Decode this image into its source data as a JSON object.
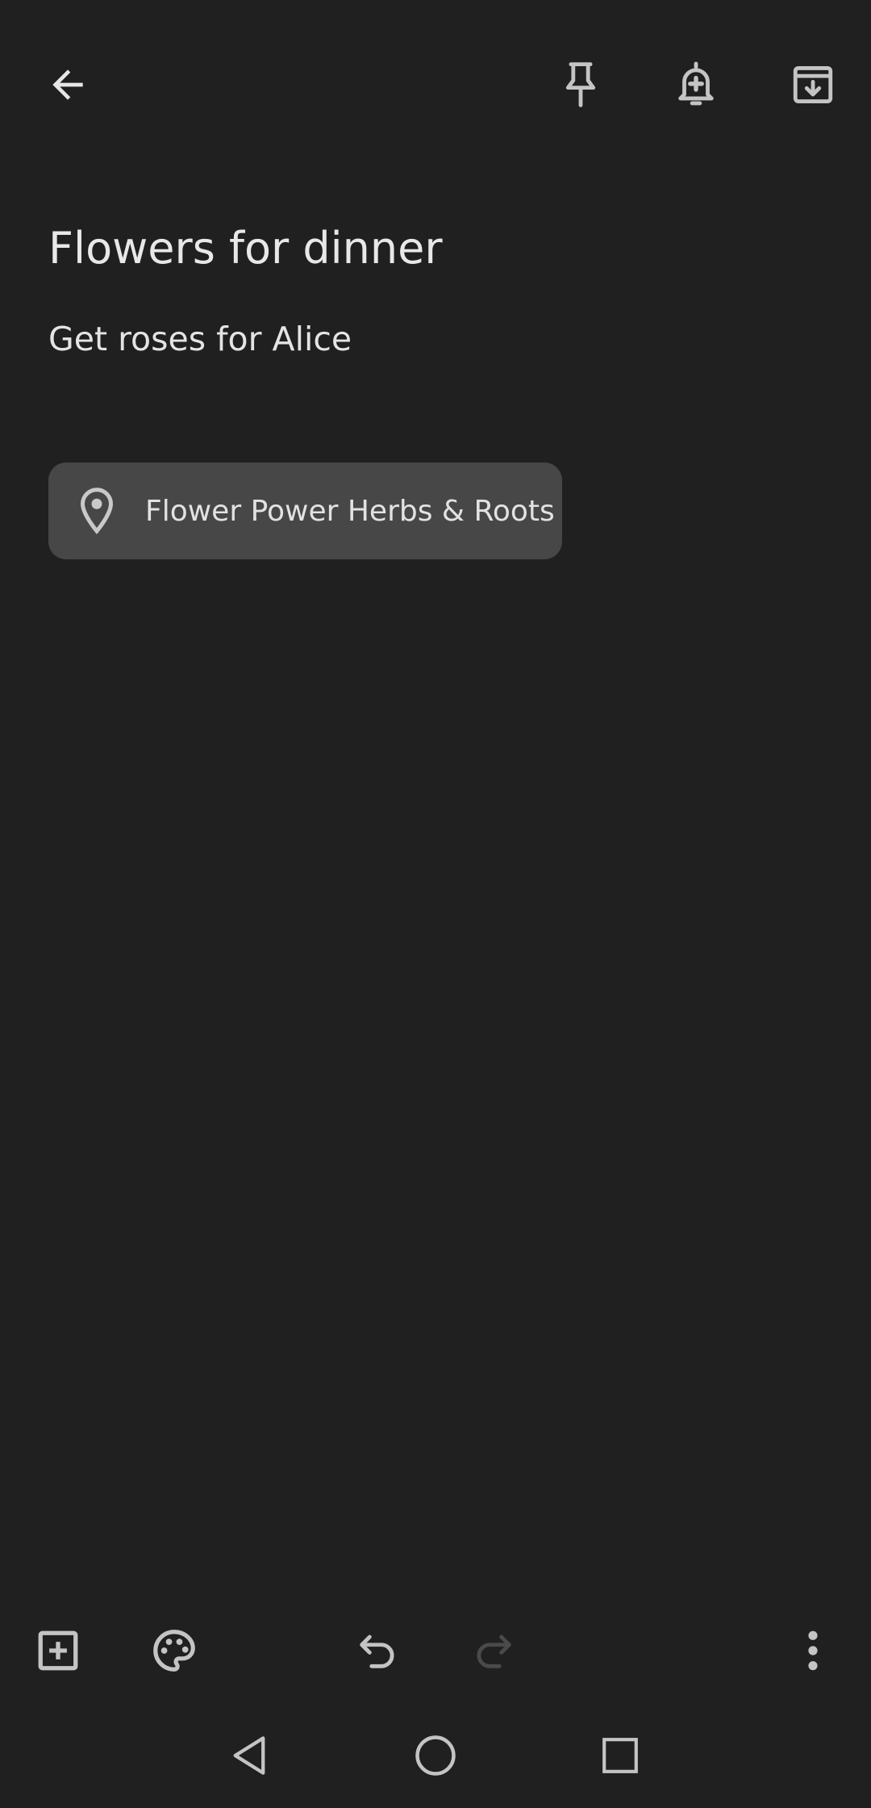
{
  "toolbar": {
    "back_icon": "arrow-back-icon",
    "pin_icon": "pin-icon",
    "reminder_icon": "add-reminder-icon",
    "archive_icon": "archive-icon"
  },
  "note": {
    "title": "Flowers for dinner",
    "body": "Get roses for Alice"
  },
  "location": {
    "icon": "location-pin-icon",
    "label": "Flower Power Herbs & Roots"
  },
  "bottom_bar": {
    "add_icon": "add-box-icon",
    "palette_icon": "palette-icon",
    "undo_icon": "undo-icon",
    "redo_icon": "redo-icon",
    "more_icon": "more-vert-icon"
  },
  "system_nav": {
    "back_icon": "nav-back-icon",
    "home_icon": "nav-home-icon",
    "recents_icon": "nav-recents-icon"
  },
  "colors": {
    "background": "#202020",
    "chip": "#474747",
    "icon": "#c4c4c4",
    "disabled_icon": "#4a4a4a"
  }
}
